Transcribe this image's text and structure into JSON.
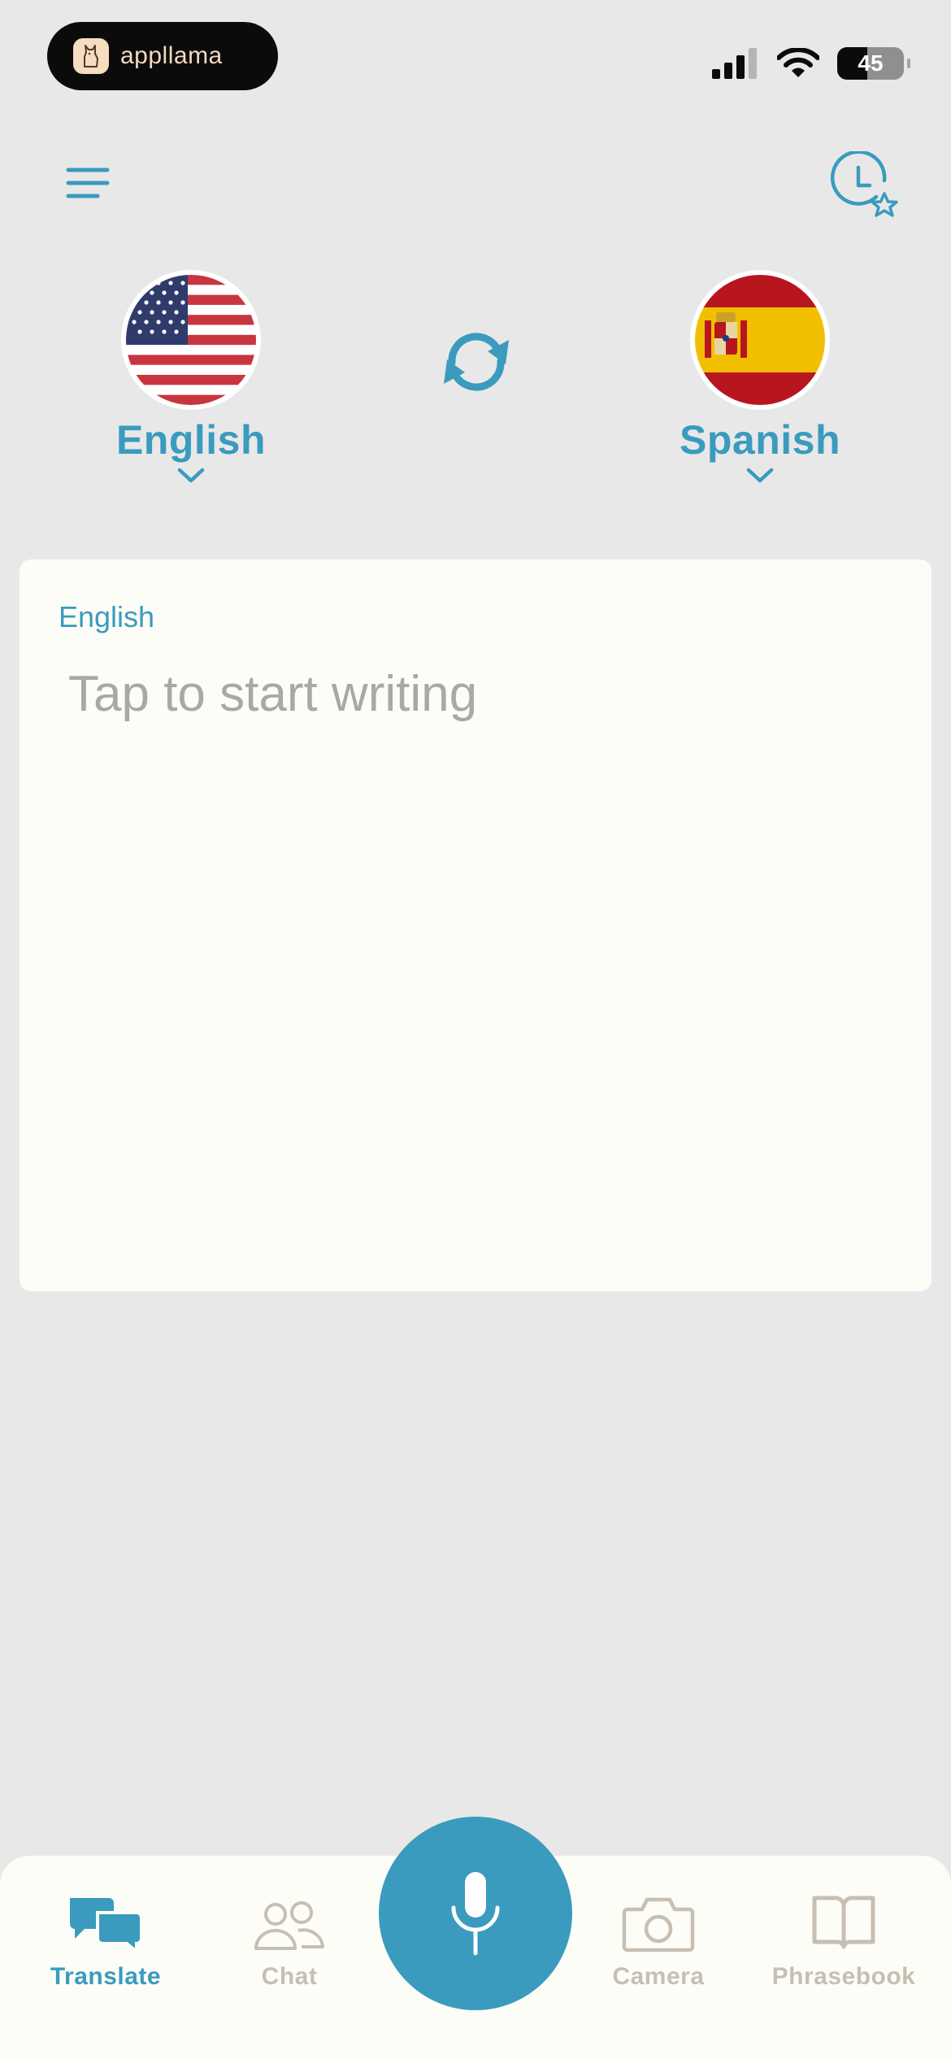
{
  "status_bar": {
    "app_pill_text": "appllama",
    "battery_level": "45"
  },
  "languages": {
    "source": "English",
    "target": "Spanish"
  },
  "input_card": {
    "language_label": "English",
    "placeholder": "Tap to start writing",
    "value": ""
  },
  "bottom_nav": {
    "items": [
      {
        "label": "Translate",
        "active": true
      },
      {
        "label": "Chat",
        "active": false
      },
      {
        "label": "Camera",
        "active": false
      },
      {
        "label": "Phrasebook",
        "active": false
      }
    ]
  },
  "colors": {
    "accent": "#3a9bbe",
    "background": "#e8e8e8",
    "card": "#fdfdf8",
    "inactive": "#c7bfb1"
  },
  "icons": {
    "menu": "hamburger-icon",
    "history": "history-favorites-icon",
    "swap": "swap-languages-icon",
    "mic": "microphone-icon"
  }
}
